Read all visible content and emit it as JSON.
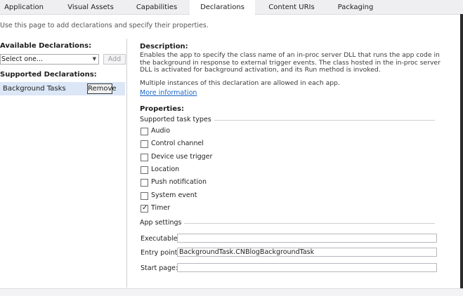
{
  "tabs": [
    {
      "label": "Application",
      "active": false
    },
    {
      "label": "Visual Assets",
      "active": false
    },
    {
      "label": "Capabilities",
      "active": false
    },
    {
      "label": "Declarations",
      "active": true
    },
    {
      "label": "Content URIs",
      "active": false
    },
    {
      "label": "Packaging",
      "active": false
    }
  ],
  "intro": "Use this page to add declarations and specify their properties.",
  "left": {
    "available_heading": "Available Declarations:",
    "select_value": "Select one...",
    "add_label": "Add",
    "supported_heading": "Supported Declarations:",
    "items": [
      {
        "label": "Background Tasks",
        "remove_label": "Remove"
      }
    ]
  },
  "description": {
    "heading": "Description:",
    "text": "Enables the app to specify the class name of an in-proc server DLL that runs the app code in the background in response to external trigger events. The class hosted in the in-proc server DLL is activated for background activation, and its Run method is invoked.",
    "multiple": "Multiple instances of this declaration are allowed in each app.",
    "more_info": "More information"
  },
  "properties": {
    "heading": "Properties:",
    "task_types_label": "Supported task types",
    "task_types": [
      {
        "label": "Audio",
        "checked": false
      },
      {
        "label": "Control channel",
        "checked": false
      },
      {
        "label": "Device use trigger",
        "checked": false
      },
      {
        "label": "Location",
        "checked": false
      },
      {
        "label": "Push notification",
        "checked": false
      },
      {
        "label": "System event",
        "checked": false
      },
      {
        "label": "Timer",
        "checked": true
      }
    ],
    "app_settings_label": "App settings",
    "fields": [
      {
        "label": "Executable:",
        "value": ""
      },
      {
        "label": "Entry point:",
        "value": "BackgroundTask.CNBlogBackgroundTask"
      },
      {
        "label": "Start page:",
        "value": ""
      }
    ]
  },
  "icons": {
    "select_chevron": "chevron-down-icon",
    "checkmark": "check-icon"
  },
  "colors": {
    "selected_row": "#dbe6f6",
    "link": "#1a64c8",
    "tab_strip": "#efeff2"
  }
}
